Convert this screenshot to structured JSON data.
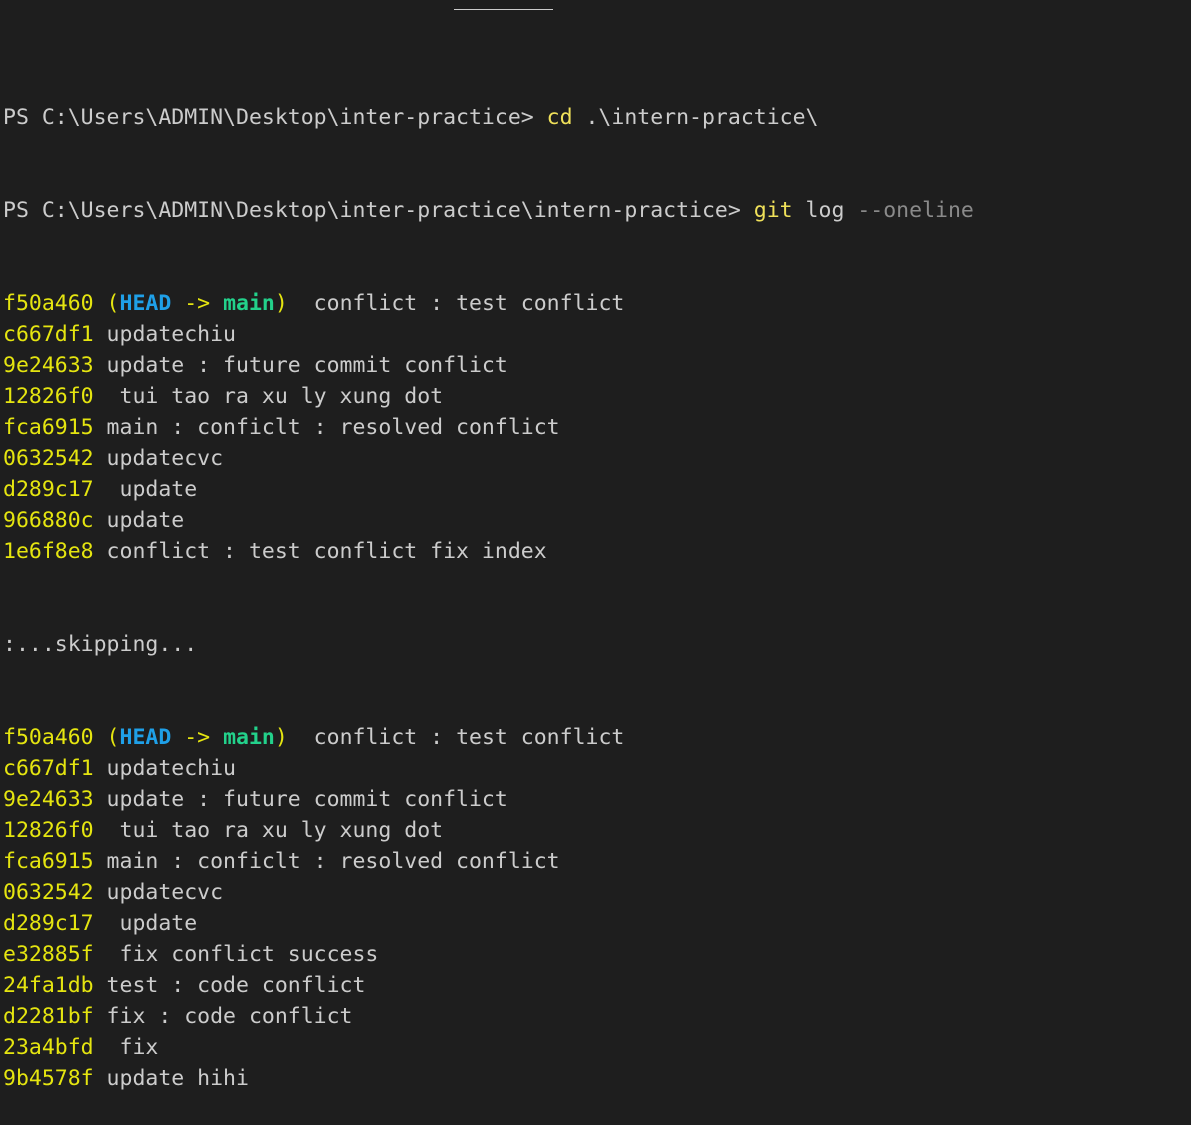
{
  "terminal": {
    "line1": {
      "prompt": "PS C:\\Users\\ADMIN\\Desktop\\inter-practice> ",
      "cmd": "cd",
      "args": " .\\intern-practice\\"
    },
    "line2": {
      "prompt": "PS C:\\Users\\ADMIN\\Desktop\\inter-practice\\intern-practice> ",
      "cmd": "git",
      "args": " log ",
      "flag": "--oneline"
    },
    "first_log": [
      {
        "hash": "f50a460",
        "decorated": true,
        "ref_open": " (",
        "head": "HEAD",
        "arrow": " -> ",
        "branch": "main",
        "ref_close": ")",
        "message": "  conflict : test conflict"
      },
      {
        "hash": "c667df1",
        "message": " updatechiu"
      },
      {
        "hash": "9e24633",
        "message": " update : future commit conflict"
      },
      {
        "hash": "12826f0",
        "message": "  tui tao ra xu ly xung dot"
      },
      {
        "hash": "fca6915",
        "message": " main : conficlt : resolved conflict"
      },
      {
        "hash": "0632542",
        "message": " updatecvc"
      },
      {
        "hash": "d289c17",
        "message": "  update"
      },
      {
        "hash": "966880c",
        "message": " update"
      },
      {
        "hash": "1e6f8e8",
        "message": " conflict : test conflict fix index"
      }
    ],
    "skipping": ":...skipping...",
    "second_log": [
      {
        "hash": "f50a460",
        "decorated": true,
        "ref_open": " (",
        "head": "HEAD",
        "arrow": " -> ",
        "branch": "main",
        "ref_close": ")",
        "message": "  conflict : test conflict"
      },
      {
        "hash": "c667df1",
        "message": " updatechiu"
      },
      {
        "hash": "9e24633",
        "message": " update : future commit conflict"
      },
      {
        "hash": "12826f0",
        "message": "  tui tao ra xu ly xung dot"
      },
      {
        "hash": "fca6915",
        "message": " main : conficlt : resolved conflict"
      },
      {
        "hash": "0632542",
        "message": " updatecvc"
      },
      {
        "hash": "d289c17",
        "message": "  update"
      },
      {
        "hash": "e32885f",
        "message": "  fix conflict success"
      },
      {
        "hash": "24fa1db",
        "message": " test : code conflict"
      },
      {
        "hash": "d2281bf",
        "message": " fix : code conflict"
      },
      {
        "hash": "23a4bfd",
        "message": "  fix"
      },
      {
        "hash": "9b4578f",
        "message": " update hihi"
      }
    ]
  }
}
